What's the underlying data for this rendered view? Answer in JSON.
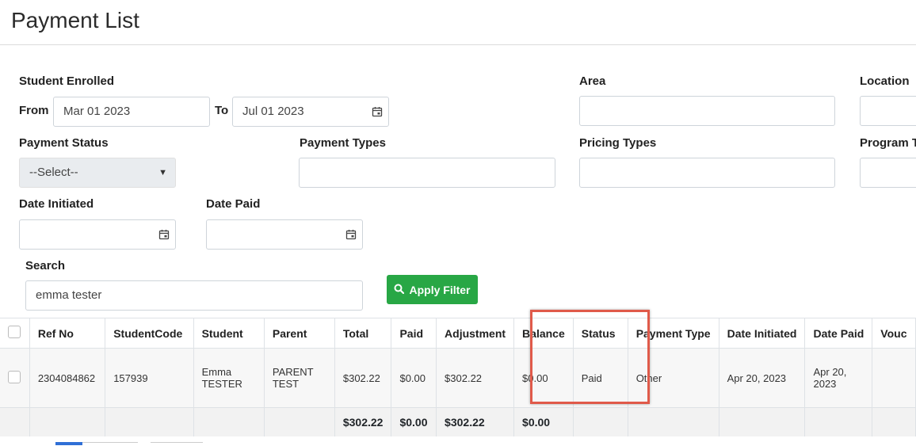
{
  "page": {
    "title": "Payment List"
  },
  "filters": {
    "student_enrolled_label": "Student Enrolled",
    "from_label": "From",
    "from_value": "Mar 01 2023",
    "to_label": "To",
    "to_value": "Jul 01 2023",
    "area_label": "Area",
    "area_value": "",
    "location_label": "Location",
    "location_value": "",
    "payment_status_label": "Payment Status",
    "payment_status_value": "--Select--",
    "payment_types_label": "Payment Types",
    "payment_types_value": "",
    "pricing_types_label": "Pricing Types",
    "pricing_types_value": "",
    "program_types_label": "Program T",
    "program_types_value": "",
    "date_initiated_label": "Date Initiated",
    "date_initiated_value": "",
    "date_paid_label": "Date Paid",
    "date_paid_value": "",
    "search_label": "Search",
    "search_value": "emma tester",
    "apply_button_label": "Apply Filter"
  },
  "table": {
    "columns": [
      "",
      "Ref No",
      "StudentCode",
      "Student",
      "Parent",
      "Total",
      "Paid",
      "Adjustment",
      "Balance",
      "Status",
      "Payment Type",
      "Date Initiated",
      "Date Paid",
      "Vouc"
    ],
    "rows": [
      {
        "ref_no": "2304084862",
        "student_code": "157939",
        "student": "Emma TESTER",
        "parent": "PARENT TEST",
        "total": "$302.22",
        "paid": "$0.00",
        "adjustment": "$302.22",
        "balance": "$0.00",
        "status": "Paid",
        "payment_type": "Other",
        "date_initiated": "Apr 20, 2023",
        "date_paid": "Apr 20, 2023",
        "voucher": ""
      }
    ],
    "totals": {
      "total": "$302.22",
      "paid": "$0.00",
      "adjustment": "$302.22",
      "balance": "$0.00"
    }
  },
  "icons": {
    "calendar": "calendar-icon",
    "search": "search-icon",
    "dropdown": "chevron-down-icon"
  },
  "colors": {
    "apply_button": "#28a745",
    "link": "#3a8fc4",
    "highlight": "#e05a4a"
  }
}
